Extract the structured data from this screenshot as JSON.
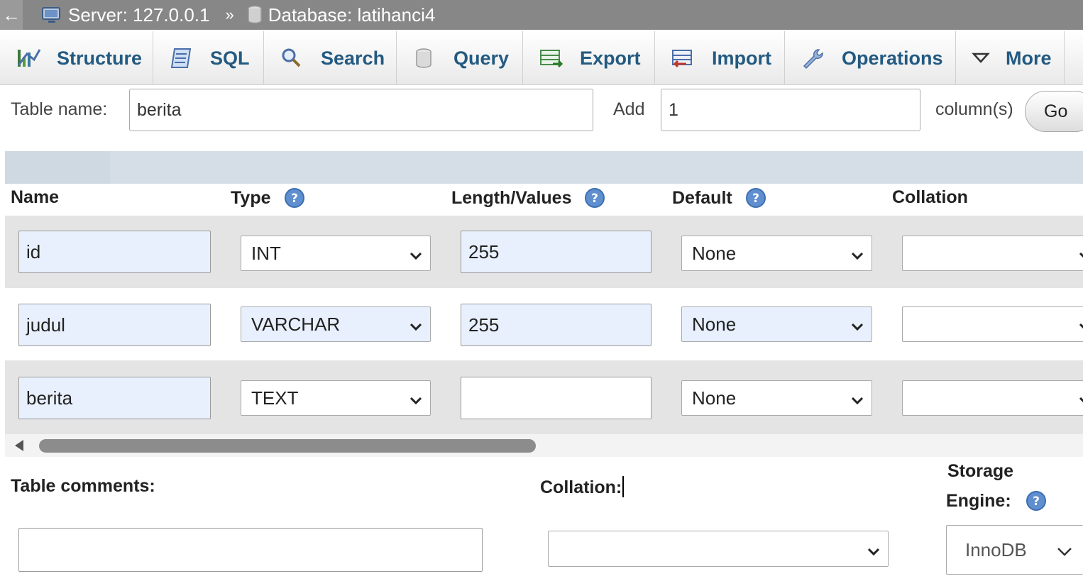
{
  "breadcrumb": {
    "back_glyph": "←",
    "server_label": "Server: 127.0.0.1",
    "separator": "»",
    "database_label": "Database: latihanci4"
  },
  "tabs": [
    {
      "label": "Structure",
      "icon": "structure-icon"
    },
    {
      "label": "SQL",
      "icon": "sql-icon"
    },
    {
      "label": "Search",
      "icon": "search-icon"
    },
    {
      "label": "Query",
      "icon": "query-icon"
    },
    {
      "label": "Export",
      "icon": "export-icon"
    },
    {
      "label": "Import",
      "icon": "import-icon"
    },
    {
      "label": "Operations",
      "icon": "wrench-icon"
    },
    {
      "label": "More",
      "icon": "triangle-down-icon"
    }
  ],
  "table_form": {
    "table_name_label": "Table name:",
    "table_name_value": "berita",
    "add_label": "Add",
    "add_value": "1",
    "columns_label": "column(s)",
    "go_label": "Go"
  },
  "columns_header": {
    "name": "Name",
    "type": "Type",
    "length": "Length/Values",
    "default": "Default",
    "collation": "Collation"
  },
  "fields": [
    {
      "name": "id",
      "type": "INT",
      "length": "255",
      "default": "None",
      "collation": ""
    },
    {
      "name": "judul",
      "type": "VARCHAR",
      "length": "255",
      "default": "None",
      "collation": ""
    },
    {
      "name": "berita",
      "type": "TEXT",
      "length": "",
      "default": "None",
      "collation": ""
    }
  ],
  "table_options": {
    "comments_label": "Table comments:",
    "comments_value": "",
    "collation_label": "Collation:",
    "collation_value": "",
    "storage_label_line1": "Storage",
    "storage_label_line2": "Engine:",
    "storage_value": "InnoDB"
  },
  "colors": {
    "tab_text": "#235a81",
    "topbar_bg": "#878787",
    "row_grey": "#e4e4e4",
    "input_blue": "#e8f0fe",
    "help_icon": "#5f8fcf"
  }
}
